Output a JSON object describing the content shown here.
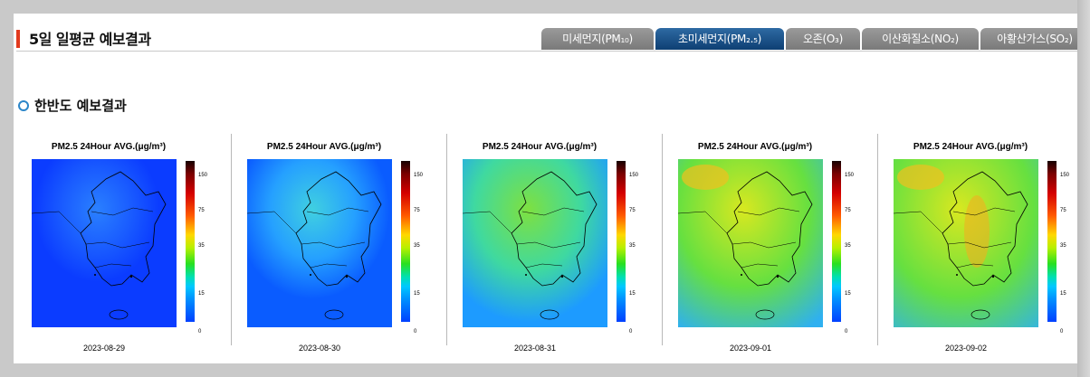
{
  "header": {
    "title": "5일 일평균 예보결과"
  },
  "tabs": [
    {
      "label": "미세먼지(PM₁₀)",
      "active": false
    },
    {
      "label": "초미세먼지(PM₂.₅)",
      "active": true
    },
    {
      "label": "오존(O₃)",
      "active": false
    },
    {
      "label": "이산화질소(NO₂)",
      "active": false
    },
    {
      "label": "아황산가스(SO₂)",
      "active": false
    }
  ],
  "section": {
    "title": "한반도 예보결과"
  },
  "colors": {
    "accent_bar": "#e23a1e",
    "tab_active": "#0e3f73",
    "tab_inactive": "#808080",
    "bullet": "#2c86c9"
  },
  "colorbar_ticks": [
    "150",
    "75",
    "35",
    "15",
    "0"
  ],
  "maps": [
    {
      "title": "PM2.5 24Hour AVG.(μg/m³)",
      "date": "2023-08-29",
      "level": 0.05
    },
    {
      "title": "PM2.5 24Hour AVG.(μg/m³)",
      "date": "2023-08-30",
      "level": 0.22
    },
    {
      "title": "PM2.5 24Hour AVG.(μg/m³)",
      "date": "2023-08-31",
      "level": 0.45
    },
    {
      "title": "PM2.5 24Hour AVG.(μg/m³)",
      "date": "2023-09-01",
      "level": 0.72
    },
    {
      "title": "PM2.5 24Hour AVG.(μg/m³)",
      "date": "2023-09-02",
      "level": 0.9
    }
  ]
}
